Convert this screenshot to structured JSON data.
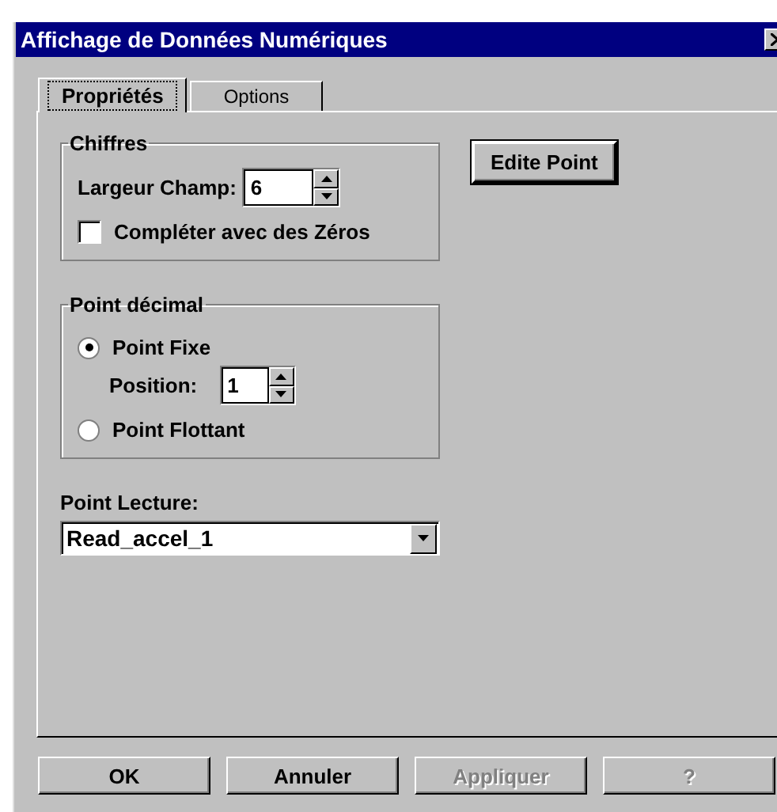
{
  "window": {
    "title": "Affichage de Données Numériques"
  },
  "tabs": [
    {
      "label": "Propriétés",
      "selected": true
    },
    {
      "label": "Options",
      "selected": false
    }
  ],
  "digits_group": {
    "title": "Chiffres",
    "field_label": "Largeur Champ:",
    "field_value": "6",
    "checkbox": {
      "label": "Compléter avec des Zéros",
      "checked": false
    }
  },
  "edit_button": "Edite Point",
  "decimal_group": {
    "title": "Point décimal",
    "options": [
      {
        "label": "Point Fixe",
        "selected": true
      },
      {
        "label": "Point Flottant",
        "selected": false
      }
    ],
    "position_label": "Position:",
    "position_value": "1"
  },
  "read_point": {
    "label": "Point Lecture:",
    "value": "Read_accel_1"
  },
  "buttons": [
    {
      "label": "OK",
      "disabled": false
    },
    {
      "label": "Annuler",
      "disabled": false
    },
    {
      "label": "Appliquer",
      "disabled": true
    },
    {
      "label": "?",
      "disabled": true
    }
  ]
}
